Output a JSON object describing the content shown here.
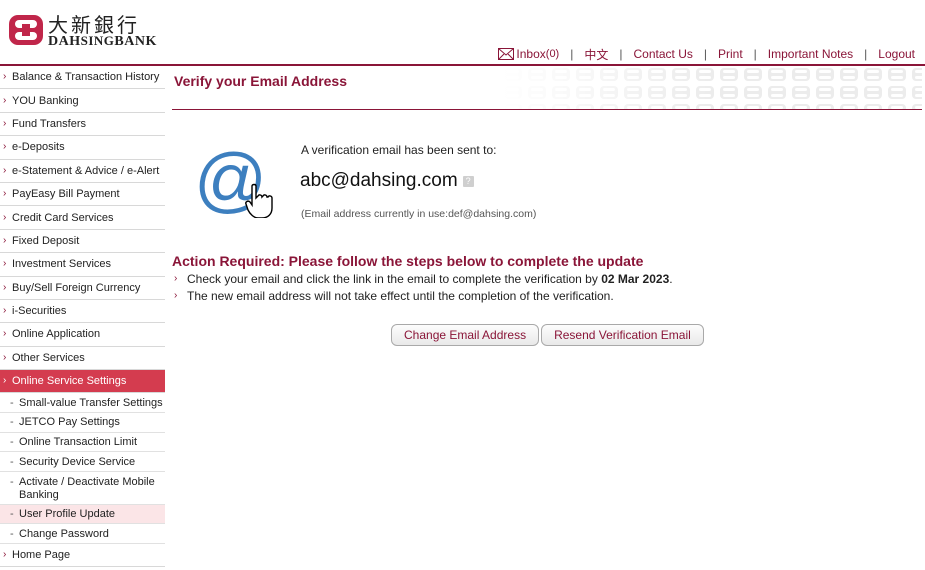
{
  "brand": {
    "name_cn": "大新銀行",
    "name_en_dah": "DAH",
    "name_en_sing": "SING",
    "name_en_bank": "BANK",
    "logo_color": "#c0264a"
  },
  "topnav": {
    "inbox_label": "Inbox",
    "inbox_count": "(0)",
    "language_label": "中文",
    "contact_label": "Contact Us",
    "print_label": "Print",
    "notes_label": "Important Notes",
    "logout_label": "Logout",
    "separator": "|"
  },
  "sidebar": {
    "items": [
      {
        "label": "Balance & Transaction History"
      },
      {
        "label": "YOU Banking"
      },
      {
        "label": "Fund Transfers"
      },
      {
        "label": "e-Deposits"
      },
      {
        "label": "e-Statement & Advice / e-Alert"
      },
      {
        "label": "PayEasy Bill Payment"
      },
      {
        "label": "Credit Card Services"
      },
      {
        "label": "Fixed Deposit"
      },
      {
        "label": "Investment Services"
      },
      {
        "label": "Buy/Sell Foreign Currency"
      },
      {
        "label": "i-Securities"
      },
      {
        "label": "Online Application"
      },
      {
        "label": "Other Services"
      },
      {
        "label": "Online Service Settings"
      }
    ],
    "subitems": [
      {
        "label": "Small-value Transfer Settings"
      },
      {
        "label": "JETCO Pay Settings"
      },
      {
        "label": "Online Transaction Limit"
      },
      {
        "label": "Security Device Service"
      },
      {
        "label": "Activate / Deactivate Mobile Banking"
      },
      {
        "label": "User Profile Update"
      },
      {
        "label": "Change Password"
      }
    ],
    "home": {
      "label": "Home Page"
    },
    "active_color": "#d43c4f"
  },
  "main": {
    "title": "Verify your Email Address",
    "sent_label": "A verification email has been sent to:",
    "new_email": "abc@dahsing.com",
    "help_icon": "?",
    "current_email_label": "(Email address currently in use:",
    "current_email_value": "def@dahsing.com",
    "current_email_close": ")",
    "action_title": "Action Required: Please follow the steps below to complete the update",
    "steps": [
      {
        "text_before": "Check your email and click the link in the email to complete the verification by ",
        "date": "02 Mar 2023",
        "text_after": "."
      },
      {
        "text": "The new email address will not take effect until the completion of the verification."
      }
    ],
    "buttons": {
      "change_email": "Change Email Address",
      "resend": "Resend Verification Email"
    },
    "accent_color": "#8a1538",
    "at_icon": "at-sign-icon",
    "cursor_icon": "hand-pointer-icon"
  }
}
